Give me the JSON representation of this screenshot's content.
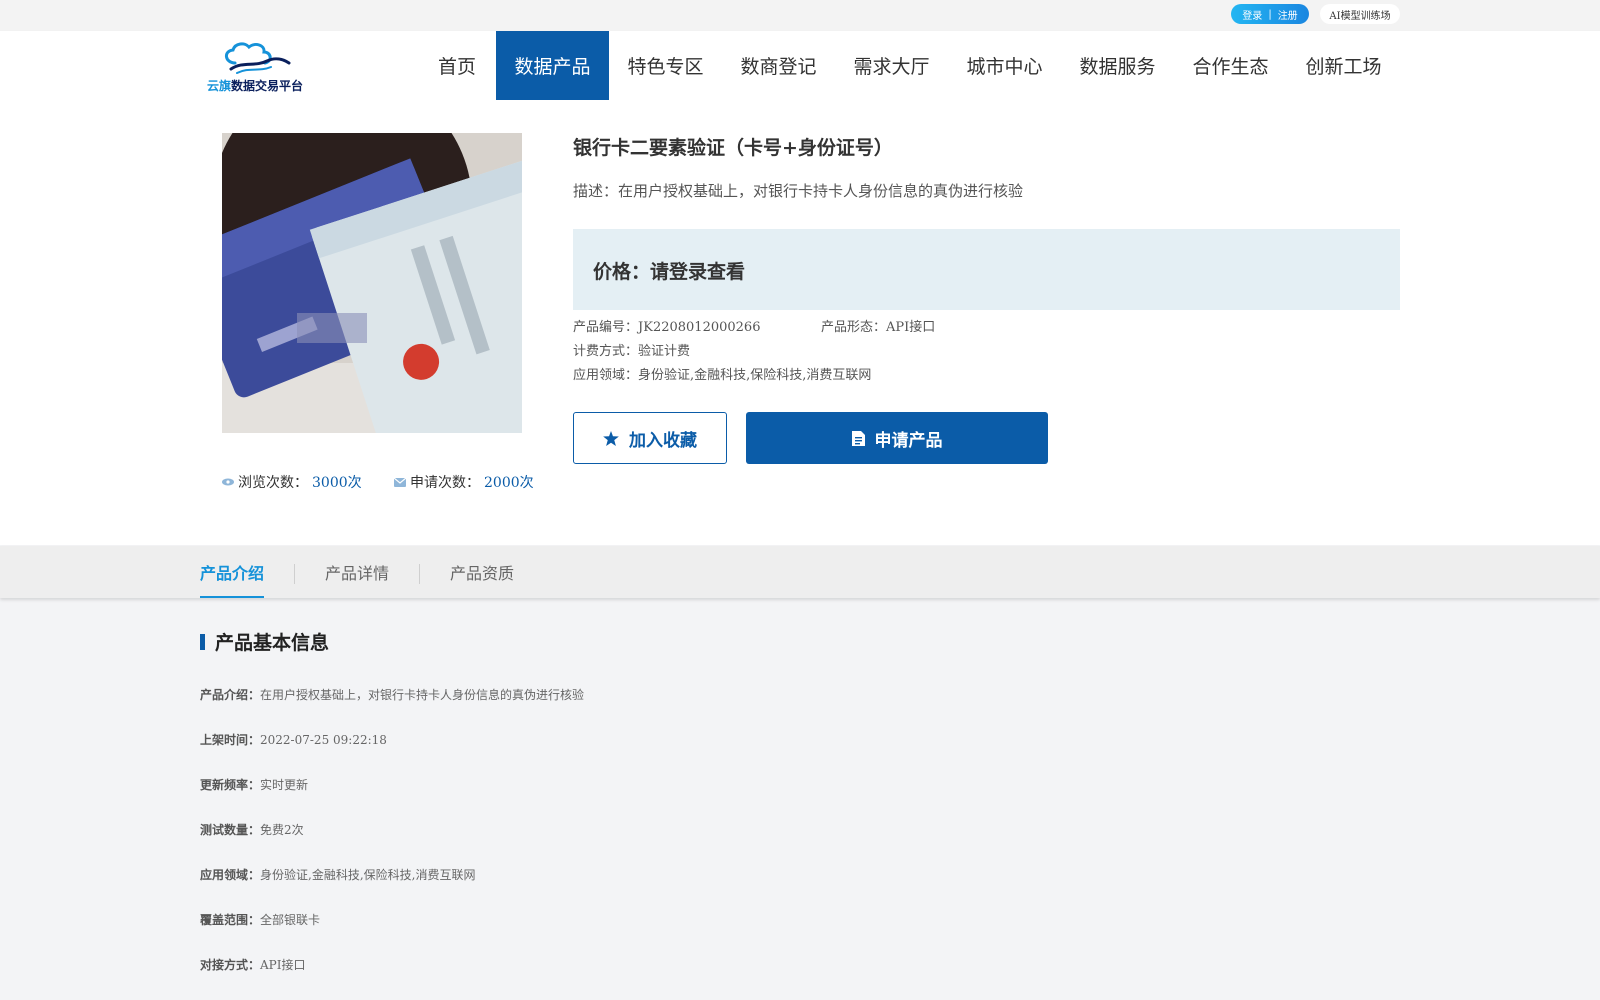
{
  "topbar": {
    "login": "登录",
    "separator": "|",
    "register": "注册",
    "ai_training": "AI模型训练场"
  },
  "logo": {
    "text_a": "云旗",
    "text_b": "数据交易平台",
    "icon": "cloud-wave-logo-icon",
    "colors": {
      "primary": "#1592d9",
      "dark": "#0a1f5c"
    }
  },
  "nav": {
    "items": [
      {
        "label": "首页",
        "active": false
      },
      {
        "label": "数据产品",
        "active": true
      },
      {
        "label": "特色专区",
        "active": false
      },
      {
        "label": "数商登记",
        "active": false
      },
      {
        "label": "需求大厅",
        "active": false
      },
      {
        "label": "城市中心",
        "active": false
      },
      {
        "label": "数据服务",
        "active": false
      },
      {
        "label": "合作生态",
        "active": false
      },
      {
        "label": "创新工场",
        "active": false
      }
    ],
    "active_color": "#0b5ca8"
  },
  "product": {
    "title": "银行卡二要素验证（卡号+身份证号）",
    "description": "描述：在用户授权基础上，对银行卡持卡人身份信息的真伪进行核验",
    "price": "价格：请登录查看",
    "code_label": "产品编号：",
    "code": "JK2208012000266",
    "form_label": "产品形态：",
    "form": "API接口",
    "billing_label": "计费方式：",
    "billing": "验证计费",
    "domain_label": "应用领域：",
    "domain": "身份验证,金融科技,保险科技,消费互联网",
    "views_label": "浏览次数：",
    "views": "3000次",
    "applies_label": "申请次数：",
    "applies": "2000次",
    "favorite_button": "加入收藏",
    "apply_button": "申请产品",
    "image_icon": "bank-card-and-id-card-photo"
  },
  "tabs": {
    "items": [
      {
        "label": "产品介绍",
        "active": true
      },
      {
        "label": "产品详情",
        "active": false
      },
      {
        "label": "产品资质",
        "active": false
      }
    ],
    "active_color": "#1592d9"
  },
  "basic_info": {
    "title": "产品基本信息",
    "rows": [
      {
        "label": "产品介绍：",
        "value": "在用户授权基础上，对银行卡持卡人身份信息的真伪进行核验"
      },
      {
        "label": "上架时间：",
        "value": "2022-07-25 09:22:18"
      },
      {
        "label": "更新频率：",
        "value": "实时更新"
      },
      {
        "label": "测试数量：",
        "value": "免费2次"
      },
      {
        "label": "应用领域：",
        "value": "身份验证,金融科技,保险科技,消费互联网"
      },
      {
        "label": "覆盖范围：",
        "value": "全部银联卡"
      },
      {
        "label": "对接方式：",
        "value": "API接口"
      }
    ]
  }
}
